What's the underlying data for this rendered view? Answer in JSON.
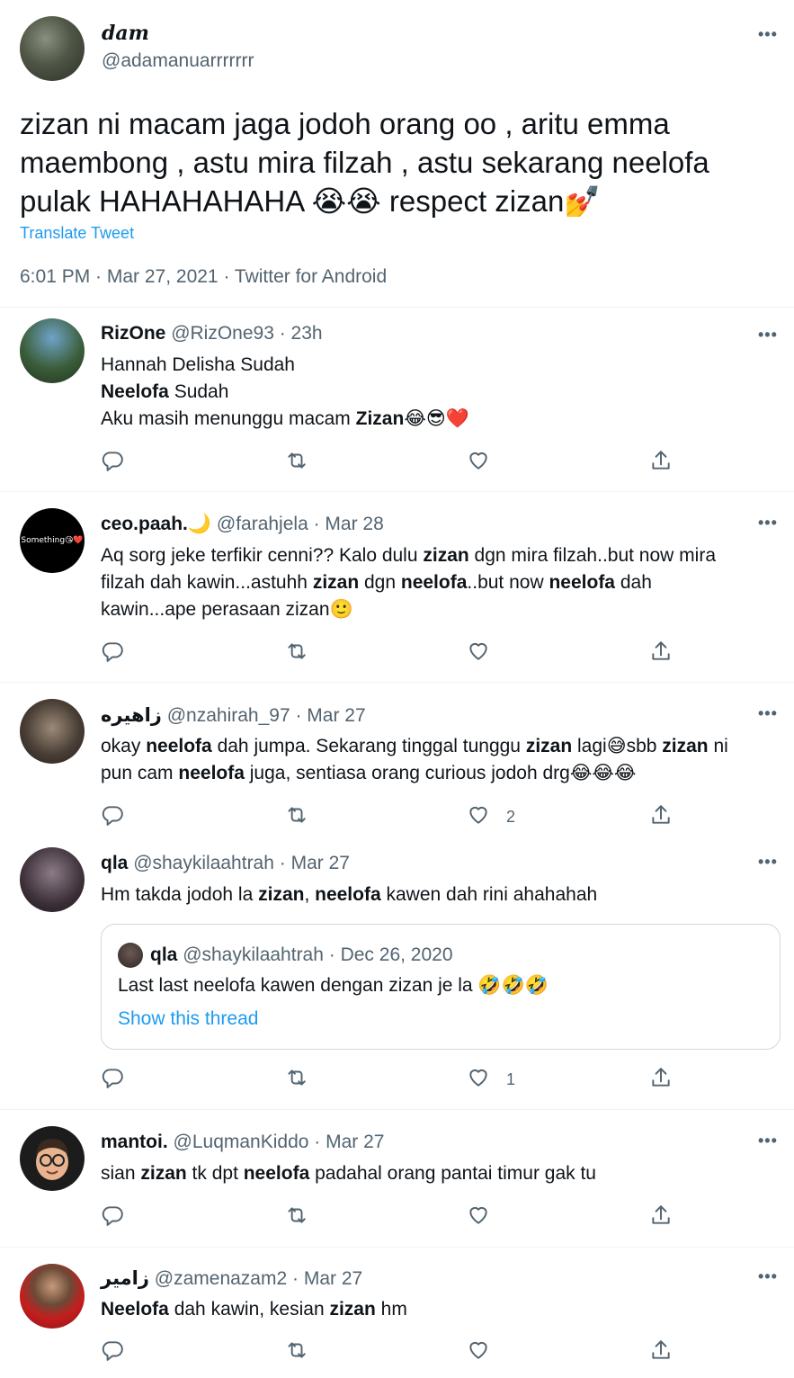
{
  "main_tweet": {
    "display_name": "dam",
    "handle": "@adamanuarrrrrrr",
    "text": "zizan ni macam jaga jodoh orang oo , aritu emma maembong , astu mira filzah , astu sekarang neelofa pulak HAHAHAHAHA 😭😭 respect zizan💅",
    "translate_label": "Translate Tweet",
    "meta": "6:01 PM · Mar 27, 2021 · Twitter for Android"
  },
  "replies": [
    {
      "display_name": "RizOne",
      "handle_time": "@RizOne93 · 23h",
      "body_lines": [
        {
          "parts": [
            {
              "t": "Hannah Delisha Sudah",
              "b": false
            }
          ]
        },
        {
          "parts": [
            {
              "t": "Neelofa",
              "b": true
            },
            {
              "t": " Sudah",
              "b": false
            }
          ]
        },
        {
          "parts": [
            {
              "t": "Aku masih menunggu macam ",
              "b": false
            },
            {
              "t": "Zizan",
              "b": true
            },
            {
              "t": "😂😎❤️",
              "b": false
            }
          ]
        }
      ],
      "like_count": ""
    },
    {
      "display_name": "ceo.paah.🌙",
      "handle_time": "@farahjela · Mar 28",
      "avatar_text": "Something😘❤️",
      "body_lines": [
        {
          "parts": [
            {
              "t": "Aq sorg jeke terfikir cenni?? Kalo dulu ",
              "b": false
            },
            {
              "t": "zizan",
              "b": true
            },
            {
              "t": " dgn mira filzah..but now mira",
              "b": false
            }
          ]
        },
        {
          "parts": [
            {
              "t": "filzah dah kawin...astuhh ",
              "b": false
            },
            {
              "t": "zizan",
              "b": true
            },
            {
              "t": " dgn ",
              "b": false
            },
            {
              "t": "neelofa",
              "b": true
            },
            {
              "t": "..but now ",
              "b": false
            },
            {
              "t": "neelofa",
              "b": true
            },
            {
              "t": " dah",
              "b": false
            }
          ]
        },
        {
          "parts": [
            {
              "t": "kawin...ape perasaan zizan🙂",
              "b": false
            }
          ]
        }
      ],
      "like_count": ""
    },
    {
      "display_name": "زاهيره",
      "handle_time": "@nzahirah_97 · Mar 27",
      "body_lines": [
        {
          "parts": [
            {
              "t": "okay ",
              "b": false
            },
            {
              "t": "neelofa",
              "b": true
            },
            {
              "t": " dah jumpa. Sekarang tinggal tunggu ",
              "b": false
            },
            {
              "t": "zizan",
              "b": true
            },
            {
              "t": " lagi😅sbb ",
              "b": false
            },
            {
              "t": "zizan",
              "b": true
            },
            {
              "t": " ni",
              "b": false
            }
          ]
        },
        {
          "parts": [
            {
              "t": "pun cam ",
              "b": false
            },
            {
              "t": "neelofa",
              "b": true
            },
            {
              "t": " juga, sentiasa orang curious jodoh drg😂😂😂",
              "b": false
            }
          ]
        }
      ],
      "like_count": "2"
    },
    {
      "display_name": "qla",
      "handle_time": "@shaykilaahtrah · Mar 27",
      "body_lines": [
        {
          "parts": [
            {
              "t": "Hm takda jodoh la ",
              "b": false
            },
            {
              "t": "zizan",
              "b": true
            },
            {
              "t": ", ",
              "b": false
            },
            {
              "t": "neelofa",
              "b": true
            },
            {
              "t": " kawen dah rini ahahahah",
              "b": false
            }
          ]
        }
      ],
      "quote": {
        "display_name": "qla",
        "handle_time": "@shaykilaahtrah · Dec 26, 2020",
        "text": "Last last neelofa kawen dengan zizan je la 🤣🤣🤣",
        "link": "Show this thread"
      },
      "like_count": "1"
    },
    {
      "display_name": "mantoi.",
      "handle_time": "@LuqmanKiddo · Mar 27",
      "body_lines": [
        {
          "parts": [
            {
              "t": "sian ",
              "b": false
            },
            {
              "t": "zizan",
              "b": true
            },
            {
              "t": " tk dpt ",
              "b": false
            },
            {
              "t": "neelofa",
              "b": true
            },
            {
              "t": " padahal orang pantai timur gak tu",
              "b": false
            }
          ]
        }
      ],
      "like_count": ""
    },
    {
      "display_name": "زامير",
      "handle_time": "@zamenazam2 · Mar 27",
      "body_lines": [
        {
          "parts": [
            {
              "t": "Neelofa",
              "b": true
            },
            {
              "t": " dah kawin, kesian ",
              "b": false
            },
            {
              "t": "zizan",
              "b": true
            },
            {
              "t": " hm",
              "b": false
            }
          ]
        }
      ],
      "like_count": ""
    }
  ],
  "icons": {
    "reply": "reply-icon",
    "retweet": "retweet-icon",
    "like": "heart-icon",
    "share": "share-icon",
    "more": "more-options-icon"
  },
  "more_label": "•••",
  "colors": {
    "accent": "#1d9bf0",
    "secondary_text": "#536471",
    "divider": "#eff3f4"
  }
}
